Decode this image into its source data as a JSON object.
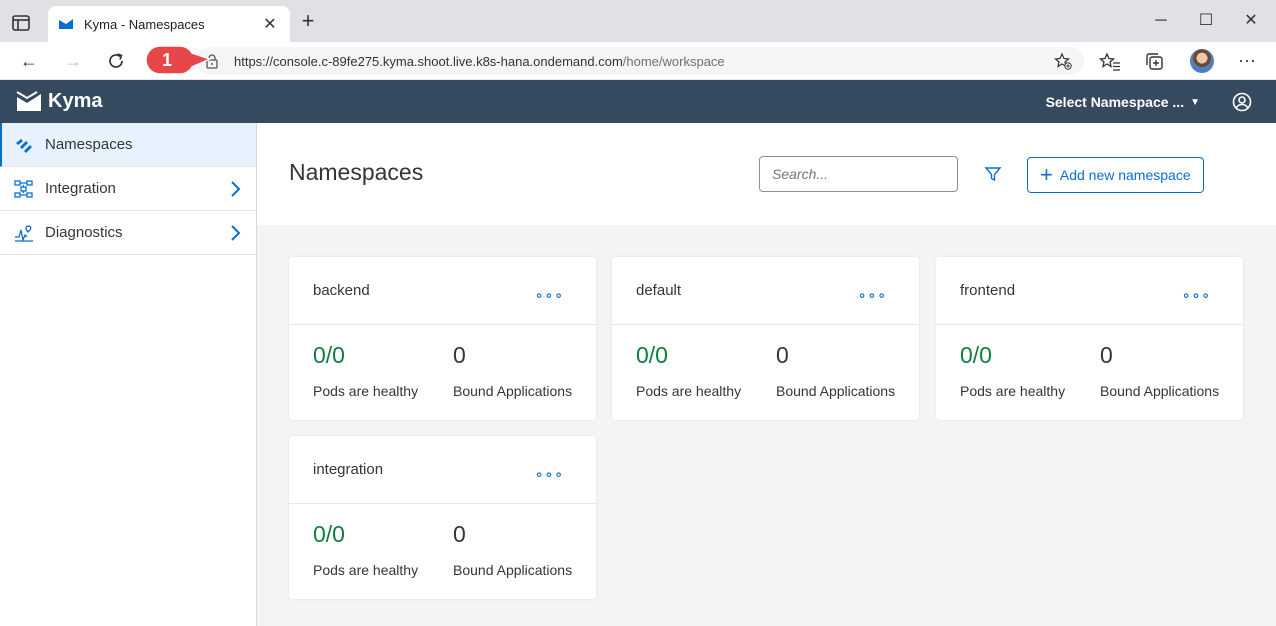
{
  "browser": {
    "tab_title": "Kyma - Namespaces",
    "url_base": "https://console.c-89fe275.kyma.shoot.live.k8s-hana.ondemand.com",
    "url_path": "/home/workspace",
    "callout_number": "1"
  },
  "shell": {
    "app_name": "Kyma",
    "namespace_select": "Select Namespace ..."
  },
  "sidebar": {
    "items": [
      {
        "label": "Namespaces",
        "active": true
      },
      {
        "label": "Integration",
        "expandable": true
      },
      {
        "label": "Diagnostics",
        "expandable": true
      }
    ]
  },
  "page": {
    "title": "Namespaces",
    "search_placeholder": "Search...",
    "add_button_label": "Add new namespace"
  },
  "namespaces": [
    {
      "name": "backend",
      "pods": "0/0",
      "pods_label": "Pods are healthy",
      "apps": "0",
      "apps_label": "Bound Applications"
    },
    {
      "name": "default",
      "pods": "0/0",
      "pods_label": "Pods are healthy",
      "apps": "0",
      "apps_label": "Bound Applications"
    },
    {
      "name": "frontend",
      "pods": "0/0",
      "pods_label": "Pods are healthy",
      "apps": "0",
      "apps_label": "Bound Applications"
    },
    {
      "name": "integration",
      "pods": "0/0",
      "pods_label": "Pods are healthy",
      "apps": "0",
      "apps_label": "Bound Applications"
    }
  ],
  "colors": {
    "shellbar": "#354a5f",
    "accent": "#0a6ed1",
    "healthy": "#107e3e",
    "callout": "#e8474a"
  }
}
